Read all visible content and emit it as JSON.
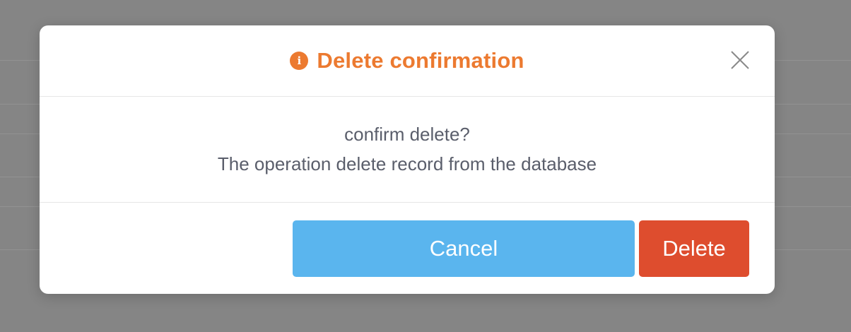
{
  "dialog": {
    "title": "Delete confirmation",
    "icon": "info-icon",
    "close_icon": "close-icon",
    "message_line1": "confirm delete?",
    "message_line2": "The operation delete record from the database",
    "cancel_label": "Cancel",
    "delete_label": "Delete"
  },
  "colors": {
    "accent_orange": "#ec7a30",
    "cancel_blue": "#5ab5ee",
    "delete_red": "#de4d2e",
    "text_gray": "#5a5e6b",
    "overlay": "#858585"
  }
}
